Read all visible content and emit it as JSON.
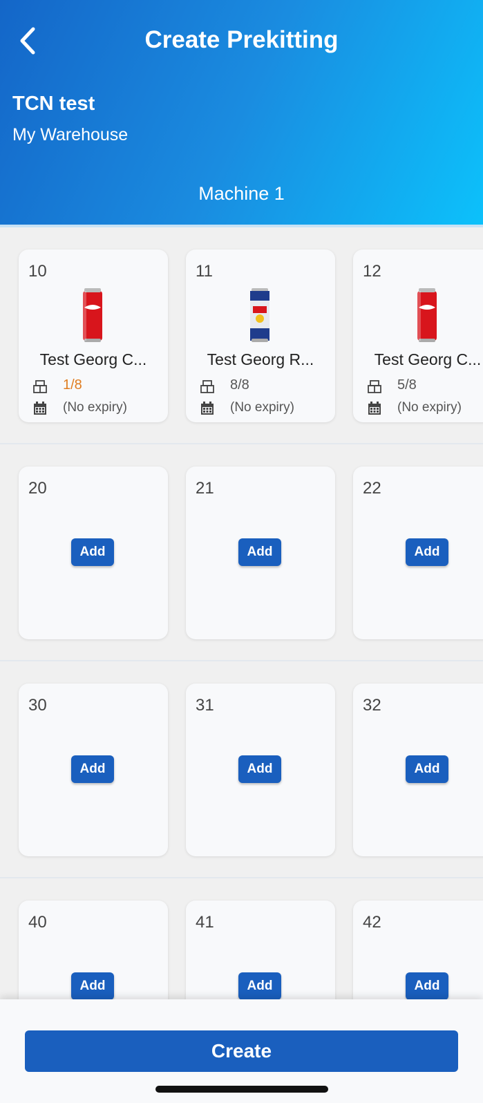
{
  "header": {
    "title": "Create Prekitting",
    "site_name": "TCN test",
    "warehouse": "My Warehouse",
    "machine": "Machine 1"
  },
  "rows": [
    {
      "slots": [
        {
          "number": "10",
          "product": "Test Georg C...",
          "stock": "1/8",
          "expiry": "(No expiry)",
          "image": "coca-cola-can"
        },
        {
          "number": "11",
          "product": "Test Georg R...",
          "stock": "8/8",
          "expiry": "(No expiry)",
          "image": "red-bull-can"
        },
        {
          "number": "12",
          "product": "Test Georg C...",
          "stock": "5/8",
          "expiry": "(No expiry)",
          "image": "coca-cola-can"
        }
      ]
    },
    {
      "slots": [
        {
          "number": "20",
          "add_label": "Add"
        },
        {
          "number": "21",
          "add_label": "Add"
        },
        {
          "number": "22",
          "add_label": "Add"
        }
      ]
    },
    {
      "slots": [
        {
          "number": "30",
          "add_label": "Add"
        },
        {
          "number": "31",
          "add_label": "Add"
        },
        {
          "number": "32",
          "add_label": "Add"
        }
      ]
    },
    {
      "slots": [
        {
          "number": "40",
          "add_label": "Add"
        },
        {
          "number": "41",
          "add_label": "Add"
        },
        {
          "number": "42",
          "add_label": "Add"
        }
      ]
    }
  ],
  "footer": {
    "create_label": "Create"
  },
  "colors": {
    "primary": "#1a5fbe",
    "header_gradient_start": "#1466c8",
    "header_gradient_end": "#0cc1fb",
    "low_stock": "#e07c1f"
  },
  "icons": {
    "back": "chevron-left-icon",
    "stock": "box-stack-icon",
    "expiry": "calendar-icon"
  }
}
